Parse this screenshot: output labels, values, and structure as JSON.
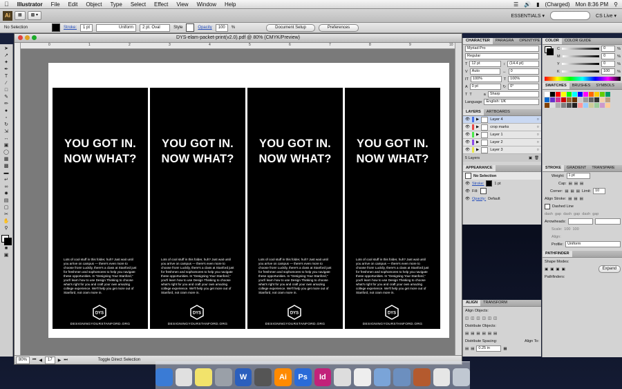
{
  "menubar": {
    "app": "Illustrator",
    "items": [
      "File",
      "Edit",
      "Object",
      "Type",
      "Select",
      "Effect",
      "View",
      "Window",
      "Help"
    ],
    "battery": "(Charged)",
    "clock": "Mon 8:36 PM"
  },
  "appbar": {
    "logo": "Ai",
    "workspace": "ESSENTIALS ▾",
    "cs_live": "CS Live ▾"
  },
  "controlbar": {
    "selection": "No Selection",
    "stroke_label": "Stroke:",
    "stroke_weight": "1 pt",
    "stroke_type": "Uniform",
    "brush": "2 pt. Oval",
    "style_label": "Style",
    "opacity_label": "Opacity",
    "opacity_value": "100",
    "opacity_unit": "%",
    "document_setup": "Document Setup",
    "preferences": "Preferences"
  },
  "document": {
    "title": "DYS-elam-packet-print(v2.0).pdf @ 80% (CMYK/Preview)",
    "zoom": "80%",
    "artboard_num": "17",
    "status": "Toggle Direct Selection",
    "ruler_ticks": [
      "0",
      "1",
      "2",
      "3",
      "4",
      "5",
      "6",
      "7",
      "8",
      "9",
      "10"
    ],
    "panel": {
      "headline_line1": "YOU GOT IN.",
      "headline_line2": "NOW WHAT?",
      "body": "Lots of cool stuff in this folder, huh? Just wait until you arrive on campus — there's even more to choose from! Luckily, there's a class at Stanford just for freshmen and sophomores to help you navigate these opportunities. In \"Designing Your Stanford,\" you'll learn how to use Design Thinking to choose what's right for you and craft your own amazing college experience. We'll help you get more out of Stanford, not cram more in.",
      "logo_text": "DYS",
      "url": "DESIGNINGYOURSTANFORD.ORG"
    },
    "panel_count": 4
  },
  "character_panel": {
    "tabs": [
      "CHARACTER",
      "PARAGRA",
      "OPENTYPE"
    ],
    "font": "Myriad Pro",
    "style": "Regular",
    "size": "12 pt",
    "leading": "(14.4 pt)",
    "kerning": "Auto",
    "tracking": "0",
    "hscale": "100%",
    "vscale": "100%",
    "baseline": "0 pt",
    "rotation": "0°",
    "aa": "Sharp",
    "language_label": "Language",
    "language": "English: UK"
  },
  "layers_panel": {
    "tabs": [
      "LAYERS",
      "ARTBOARDS"
    ],
    "layers": [
      "Layer 4",
      "crop marks",
      "Layer 1",
      "Layer 2",
      "Layer 3"
    ],
    "layer_colors": [
      "#4a74e8",
      "#e84a4a",
      "#4ae84a",
      "#8a4ae8",
      "#e8e84a"
    ],
    "count": "5 Layers"
  },
  "appearance_panel": {
    "title": "APPEARANCE",
    "selection": "No Selection",
    "stroke_label": "Stroke:",
    "stroke_value": "1 pt",
    "fill_label": "Fill:",
    "opacity_label": "Opacity:",
    "opacity_value": "Default"
  },
  "color_panel": {
    "tabs": [
      "COLOR",
      "COLOR GUIDE"
    ],
    "channels": [
      "C",
      "M",
      "Y",
      "K"
    ],
    "values": [
      "0",
      "0",
      "0",
      "100"
    ],
    "unit": "%"
  },
  "swatches_panel": {
    "tabs": [
      "SWATCHES",
      "BRUSHES",
      "SYMBOLS"
    ],
    "colors": [
      "#ffffff",
      "#000000",
      "#ff0000",
      "#ffff00",
      "#00ff00",
      "#00ffff",
      "#0000ff",
      "#ff00ff",
      "#ff6600",
      "#ffcc00",
      "#66cc00",
      "#009966",
      "#0066cc",
      "#6633cc",
      "#cc3399",
      "#cc0000",
      "#996633",
      "#663300",
      "#cccccc",
      "#999999",
      "#666666",
      "#333333",
      "#f5d0a9",
      "#c0a080",
      "#804000",
      "#e0e0e0",
      "#b0b0b0",
      "#808080",
      "#505050",
      "#202020",
      "#ff9999",
      "#99ccff",
      "#cccc99",
      "#99cc99",
      "#cc99cc",
      "#ffcc99"
    ]
  },
  "stroke_panel": {
    "tabs": [
      "STROKE",
      "GRADIENT",
      "TRANSPARE"
    ],
    "weight_label": "Weight:",
    "weight": "1 pt",
    "cap_label": "Cap:",
    "corner_label": "Corner:",
    "limit_label": "Limit:",
    "limit": "10",
    "align_label": "Align Stroke:",
    "dashed_label": "Dashed Line",
    "dash_labels": [
      "dash",
      "gap",
      "dash",
      "gap",
      "dash",
      "gap"
    ],
    "arrowheads_label": "Arrowheads:",
    "scale_label": "Scale:",
    "scale1": "100",
    "scale2": "100",
    "align_label2": "Align:",
    "profile_label": "Profile:",
    "profile": "Uniform"
  },
  "align_panel": {
    "tabs": [
      "ALIGN",
      "TRANSFORM"
    ],
    "align_objects": "Align Objects:",
    "distribute_objects": "Distribute Objects:",
    "distribute_spacing": "Distribute Spacing:",
    "align_to": "Align To:",
    "spacing_value": "0.25 in"
  },
  "pathfinder_panel": {
    "tabs": [
      "PATHFINDER"
    ],
    "shape_modes": "Shape Modes:",
    "pathfinders": "Pathfinders:",
    "expand": "Expand"
  },
  "os_dock": {
    "apps": [
      {
        "name": "finder",
        "label": "",
        "color": "#3a7bd5"
      },
      {
        "name": "chrome",
        "label": "",
        "color": "#e0e0e0"
      },
      {
        "name": "stickies",
        "label": "",
        "color": "#f2e36b"
      },
      {
        "name": "preview",
        "label": "",
        "color": "#9aa0a8"
      },
      {
        "name": "word",
        "label": "W",
        "color": "#2b5fbd"
      },
      {
        "name": "aperture",
        "label": "",
        "color": "#555"
      },
      {
        "name": "illustrator",
        "label": "Ai",
        "color": "#ff8a00"
      },
      {
        "name": "photoshop",
        "label": "Ps",
        "color": "#2a6bd8"
      },
      {
        "name": "indesign",
        "label": "Id",
        "color": "#c2227a"
      },
      {
        "name": "script-editor",
        "label": "",
        "color": "#ddd"
      },
      {
        "name": "acrobat",
        "label": "",
        "color": "#eee"
      },
      {
        "name": "preview-2",
        "label": "",
        "color": "#7aa4d8"
      },
      {
        "name": "maps",
        "label": "",
        "color": "#6c8fbf"
      },
      {
        "name": "photo-app",
        "label": "",
        "color": "#b45a2e"
      },
      {
        "name": "documents",
        "label": "",
        "color": "#e6e6e6"
      },
      {
        "name": "trash",
        "label": "",
        "color": "#c0c8d2"
      }
    ]
  }
}
